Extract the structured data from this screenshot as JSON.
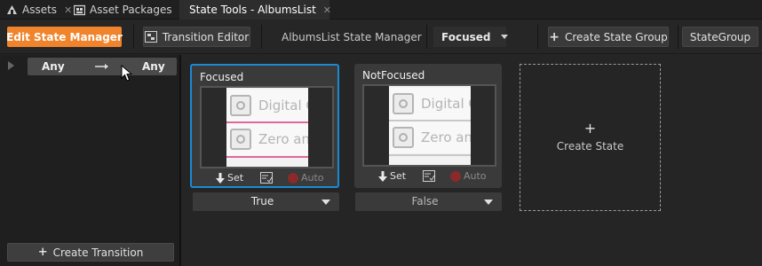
{
  "tabs": [
    {
      "label": "Assets",
      "icon": "assets-icon",
      "closable": true
    },
    {
      "label": "Asset Packages",
      "icon": "asset-packages-icon",
      "closable": true
    },
    {
      "label": "State Tools - AlbumsList",
      "icon": "state-tools-icon",
      "closable": true,
      "active": true
    }
  ],
  "toolbar": {
    "edit_state_manager": "Edit State Manager",
    "transition_editor": "Transition Editor",
    "state_manager_name": "AlbumsList State Manager",
    "state_select": "Focused",
    "create_state_group": "Create State Group",
    "state_group": "StateGroup"
  },
  "transitions": {
    "rows": [
      {
        "from": "Any",
        "to": "Any"
      }
    ],
    "create_label": "Create Transition"
  },
  "states": [
    {
      "name": "Focused",
      "selected": true,
      "preview_items": [
        "Digital C",
        "Zero and"
      ],
      "actions": {
        "set": "Set",
        "auto": "Auto"
      },
      "value": "True"
    },
    {
      "name": "NotFocused",
      "selected": false,
      "preview_items": [
        "Digital C",
        "Zero and"
      ],
      "actions": {
        "set": "Set",
        "auto": "Auto"
      },
      "value": "False"
    }
  ],
  "create_state": {
    "plus": "+",
    "label": "Create State"
  },
  "colors": {
    "accent_orange": "#f0842c",
    "selection_blue": "#1a8ad4",
    "preview_highlight": "#e0689c"
  }
}
